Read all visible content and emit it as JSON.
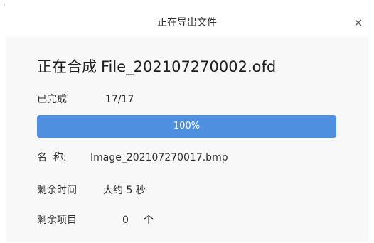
{
  "window": {
    "title": "正在导出文件",
    "close_glyph": "×"
  },
  "panel": {
    "heading_prefix": "正在合成",
    "heading_file": "File_202107270002.ofd",
    "completed": {
      "label": "已完成",
      "value": "17/17"
    },
    "progress": {
      "text": "100%",
      "fraction": 1.0,
      "color": "#4f8fe0"
    },
    "name": {
      "label": "名  称:",
      "value": "Image_202107270017.bmp"
    },
    "remaining_time": {
      "label": "剩余时间",
      "value": "大约 5 秒"
    },
    "remaining_items": {
      "label": "剩余项目",
      "count": "0",
      "unit": "个"
    }
  }
}
